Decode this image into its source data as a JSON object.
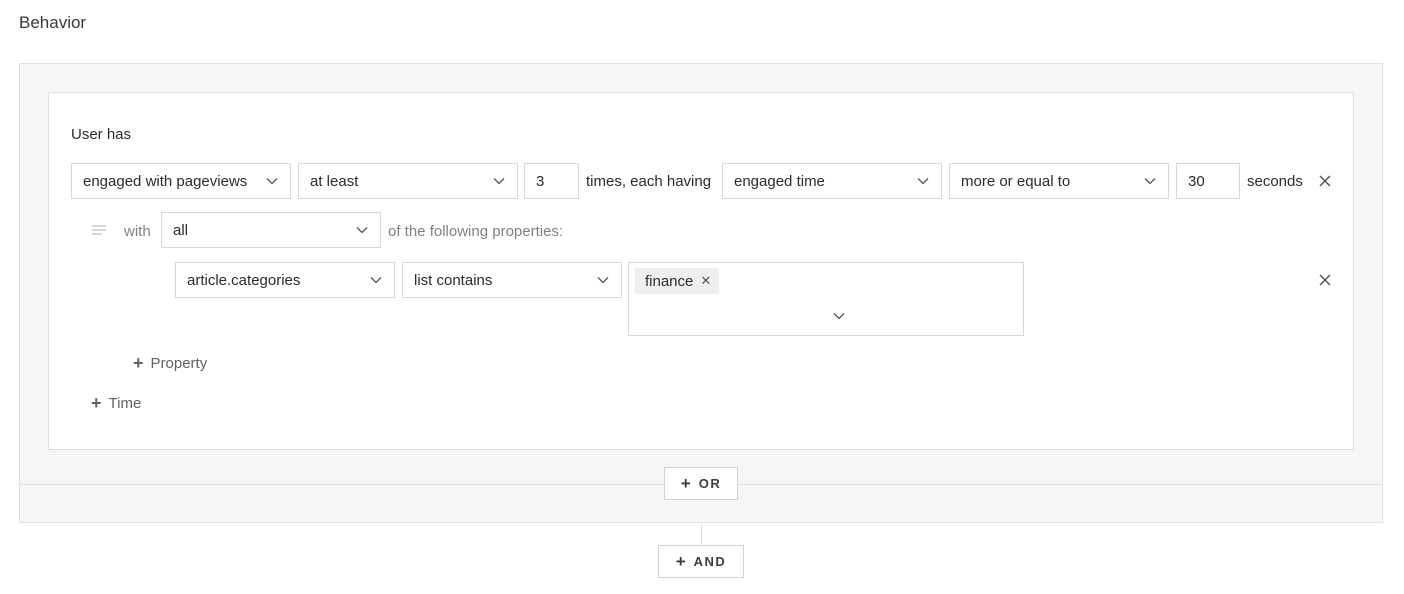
{
  "section": {
    "title": "Behavior"
  },
  "rule": {
    "user_has": "User has",
    "action_select": "engaged with pageviews",
    "qualifier_select": "at least",
    "count_value": "3",
    "times_text": "times, each having",
    "metric_select": "engaged time",
    "comparison_select": "more or equal to",
    "seconds_value": "30",
    "seconds_text": "seconds",
    "with_text": "with",
    "match_select": "all",
    "following_text": "of the following properties:",
    "property": {
      "field_select": "article.categories",
      "operator_select": "list contains",
      "tags": [
        "finance"
      ]
    },
    "add_property_label": "Property",
    "add_time_label": "Time"
  },
  "buttons": {
    "or_label": "OR",
    "and_label": "AND"
  },
  "icons": {
    "chevron": "chevron-down-icon",
    "close": "close-icon",
    "plus": "plus-icon",
    "lines": "lines-icon"
  }
}
